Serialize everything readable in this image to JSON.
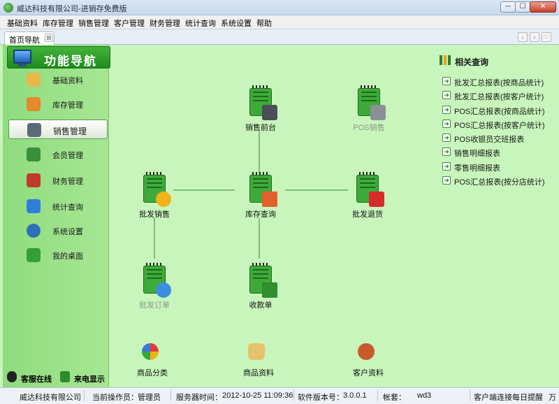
{
  "window": {
    "title": "威达科技有限公司-进销存免费版",
    "min_label": "─",
    "max_label": "☐",
    "close_label": "✕"
  },
  "menu": [
    "基础资料",
    "库存管理",
    "销售管理",
    "客户管理",
    "财务管理",
    "统计查询",
    "系统设置",
    "帮助"
  ],
  "tabs": [
    {
      "label": "首页导航",
      "close": "⊠"
    }
  ],
  "nav_controls": [
    "‹",
    "›",
    "♡"
  ],
  "sidebar": {
    "header": "功能导航",
    "items": [
      {
        "label": "基础资料",
        "icon": "pencil-icon",
        "color": "#e6b84a"
      },
      {
        "label": "库存管理",
        "icon": "cart-icon",
        "color": "#e38a2b"
      },
      {
        "label": "销售管理",
        "icon": "cash-register-icon",
        "color": "#5a6b7a",
        "active": true
      },
      {
        "label": "会员管理",
        "icon": "members-icon",
        "color": "#3a8f3a"
      },
      {
        "label": "财务管理",
        "icon": "finance-chart-icon",
        "color": "#c0392b"
      },
      {
        "label": "统计查询",
        "icon": "statistics-icon",
        "color": "#2f7ed8"
      },
      {
        "label": "系统设置",
        "icon": "settings-gears-icon",
        "color": "#2f6fb8"
      },
      {
        "label": "我的桌面",
        "icon": "desktop-icon",
        "color": "#35a035"
      }
    ],
    "online": "客服在线",
    "caller": "来电显示"
  },
  "flow": {
    "pos_register": {
      "label": "销售前台",
      "icon": "cash-register-icon"
    },
    "pos_sales": {
      "label": "POS销售",
      "icon": "pos-machine-icon",
      "disabled": true
    },
    "wholesale_sales": {
      "label": "批发销售",
      "icon": "sale-tag-icon"
    },
    "stock_query": {
      "label": "库存查询",
      "icon": "warehouse-search-icon"
    },
    "wholesale_return": {
      "label": "批发退货",
      "icon": "return-cart-icon"
    },
    "wholesale_order": {
      "label": "批发订单",
      "icon": "buy-now-icon",
      "disabled": true
    },
    "receipt": {
      "label": "收款单",
      "icon": "yuan-icon"
    }
  },
  "bottom_links": [
    {
      "label": "商品分类",
      "icon": "pie-category-icon"
    },
    {
      "label": "商品资料",
      "icon": "product-info-icon"
    },
    {
      "label": "客户资料",
      "icon": "customer-info-icon"
    }
  ],
  "related": {
    "title": "相关查询",
    "items": [
      "批发汇总报表(按商品统计)",
      "批发汇总报表(按客户统计)",
      "POS汇总报表(按商品统计)",
      "POS汇总报表(按客户统计)",
      "POS收银员交班报表",
      "销售明细报表",
      "零售明细报表",
      "POS汇总报表(按分店统计)"
    ]
  },
  "status": {
    "company": "威达科技有限公司",
    "operator_label": "当前操作员：",
    "operator": "管理员",
    "server_time_label": "服务器时间：",
    "server_time": "2012-10-25 11:09:36",
    "version_label": "软件版本号：",
    "version": "3.0.0.1",
    "account_label": "帐套：",
    "account": "wd3",
    "client_connect": "客户端连接",
    "daily_tip": "每日提醒",
    "overflow": "万"
  }
}
